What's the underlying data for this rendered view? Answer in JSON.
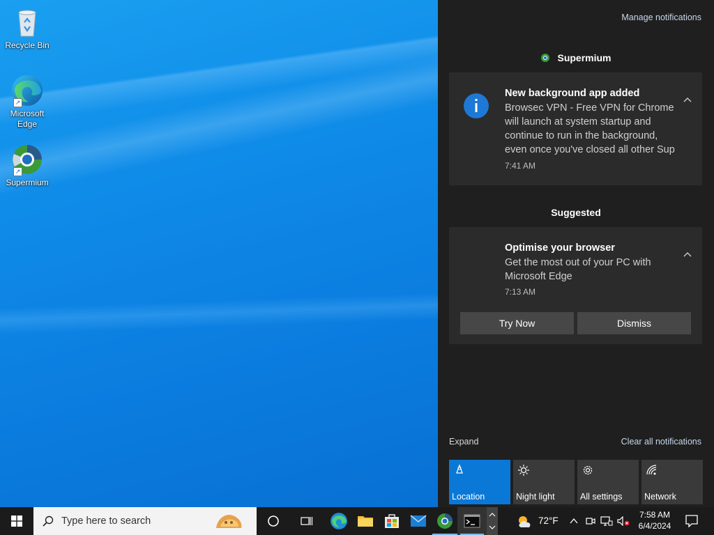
{
  "desktop": {
    "icons": [
      {
        "label": "Recycle Bin"
      },
      {
        "label": "Microsoft Edge"
      },
      {
        "label": "Supermium"
      }
    ]
  },
  "action_center": {
    "manage_notifications": "Manage notifications",
    "app_group": {
      "title": "Supermium",
      "notification": {
        "title": "New background app added",
        "body_lines": [
          "Browsec VPN - Free VPN for Chrome",
          "will launch at system startup and",
          "continue to run in the background,",
          "even once you've closed all other Sup"
        ],
        "time": "7:41 AM"
      }
    },
    "suggested_group": {
      "title": "Suggested",
      "notification": {
        "title": "Optimise your browser",
        "body_lines": [
          "Get the most out of your PC with",
          "Microsoft Edge"
        ],
        "time": "7:13 AM",
        "primary_button": "Try Now",
        "secondary_button": "Dismiss"
      }
    },
    "expand_label": "Expand",
    "clear_all_label": "Clear all notifications",
    "quick_actions": [
      {
        "label": "Location",
        "icon": "location-icon",
        "active": true
      },
      {
        "label": "Night light",
        "icon": "night-light-icon",
        "active": false
      },
      {
        "label": "All settings",
        "icon": "gear-icon",
        "active": false
      },
      {
        "label": "Network",
        "icon": "network-icon",
        "active": false
      }
    ]
  },
  "taskbar": {
    "search_placeholder": "Type here to search",
    "weather_temp": "72°F",
    "clock_time": "7:58 AM",
    "clock_date": "6/4/2024",
    "pinned": [
      "task-view",
      "edge",
      "file-explorer",
      "microsoft-store",
      "mail",
      "supermium",
      "terminal"
    ]
  },
  "colors": {
    "accent": "#0a78d7",
    "panel_bg": "#1f1f1f",
    "card_bg": "#2b2b2b",
    "taskbar_bg": "#1b1b1b"
  }
}
